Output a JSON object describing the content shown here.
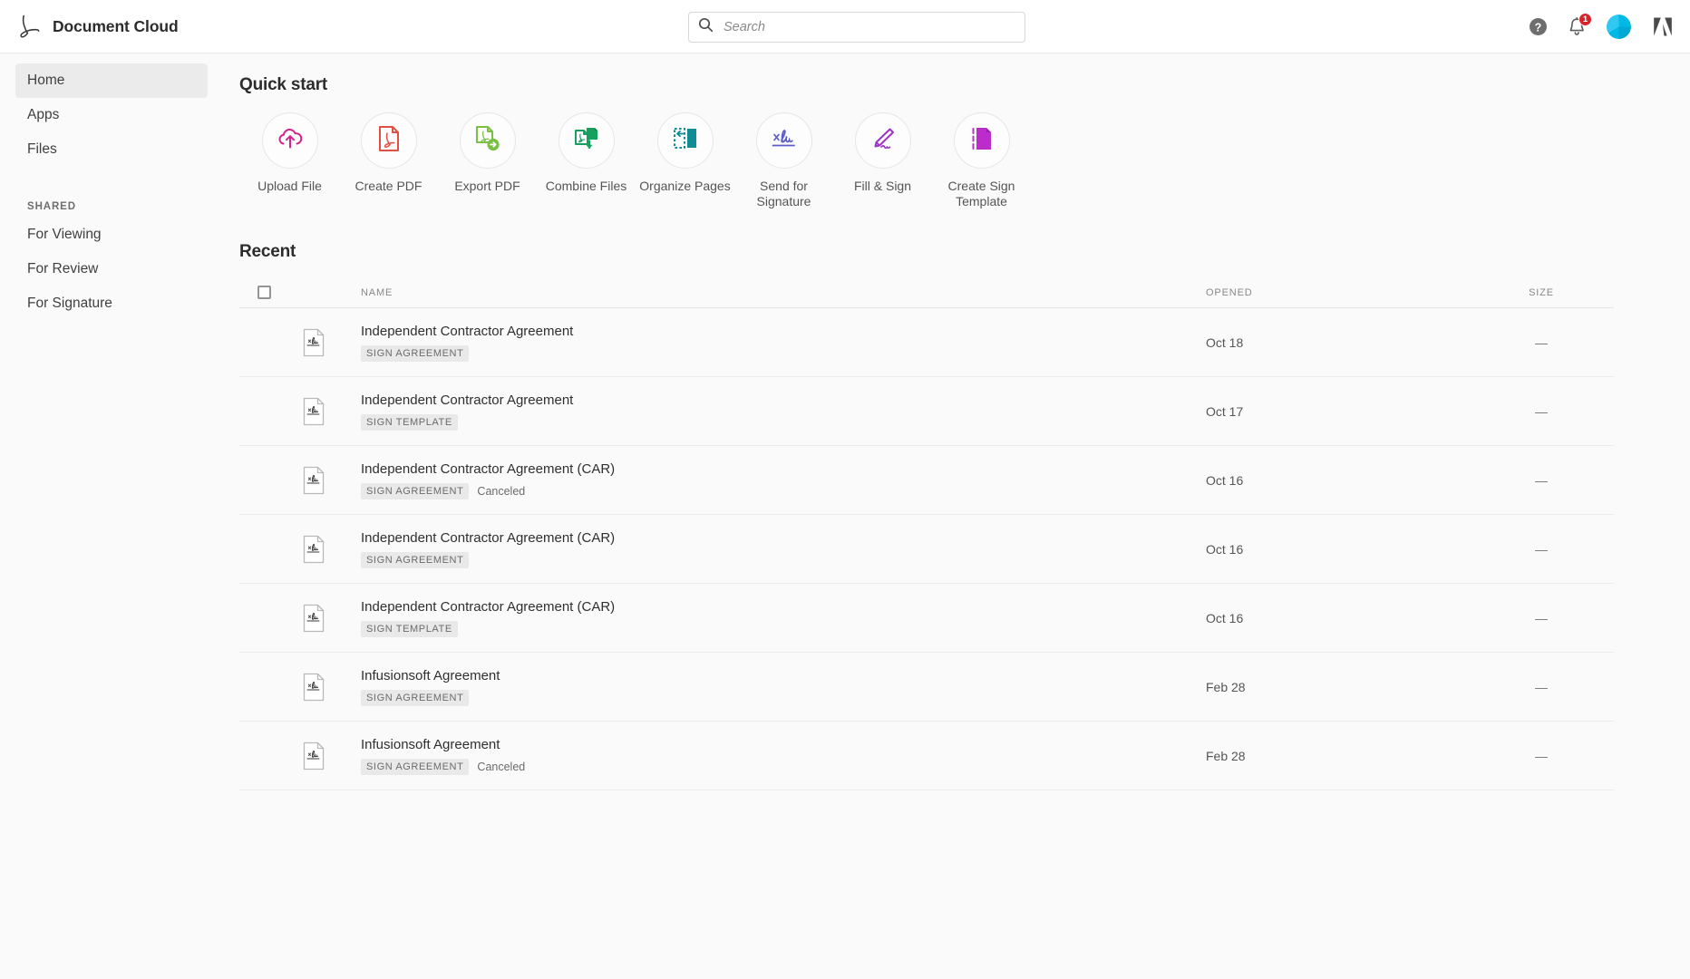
{
  "header": {
    "brand_title": "Document Cloud",
    "logo_icon": "adobe-acrobat-logo",
    "search": {
      "placeholder": "Search",
      "value": "",
      "icon": "search-icon"
    },
    "help_icon": "help-circle-icon",
    "notifications_icon": "bell-icon",
    "notifications_count": "1",
    "avatar_icon": "user-avatar",
    "adobe_logo_icon": "adobe-logo"
  },
  "sidebar": {
    "items": [
      {
        "label": "Home",
        "active": true
      },
      {
        "label": "Apps",
        "active": false
      },
      {
        "label": "Files",
        "active": false
      }
    ],
    "group_label": "SHARED",
    "shared_items": [
      {
        "label": "For Viewing"
      },
      {
        "label": "For Review"
      },
      {
        "label": "For Signature"
      }
    ]
  },
  "quick_start": {
    "title": "Quick start",
    "items": [
      {
        "label": "Upload File",
        "icon": "cloud-upload-icon",
        "color": "#d4218c"
      },
      {
        "label": "Create PDF",
        "icon": "pdf-document-icon",
        "color": "#e34f43"
      },
      {
        "label": "Export PDF",
        "icon": "export-pdf-icon",
        "color": "#7ac143"
      },
      {
        "label": "Combine Files",
        "icon": "combine-files-icon",
        "color": "#16a05d"
      },
      {
        "label": "Organize Pages",
        "icon": "organize-pages-icon",
        "color": "#0f8c94"
      },
      {
        "label": "Send for Signature",
        "icon": "signature-icon",
        "color": "#5c5ccc"
      },
      {
        "label": "Fill & Sign",
        "icon": "pen-sign-icon",
        "color": "#9b35c9"
      },
      {
        "label": "Create Sign Template",
        "icon": "sign-template-icon",
        "color": "#bb2ccb"
      }
    ]
  },
  "recent": {
    "title": "Recent",
    "columns": {
      "name": "NAME",
      "opened": "OPENED",
      "size": "SIZE"
    },
    "select_all_checked": false,
    "rows": [
      {
        "name": "Independent Contractor Agreement",
        "badge": "SIGN AGREEMENT",
        "status": "",
        "opened": "Oct 18",
        "size": "—",
        "icon": "sign-document-icon"
      },
      {
        "name": "Independent Contractor Agreement",
        "badge": "SIGN TEMPLATE",
        "status": "",
        "opened": "Oct 17",
        "size": "—",
        "icon": "sign-document-icon"
      },
      {
        "name": "Independent Contractor Agreement (CAR)",
        "badge": "SIGN AGREEMENT",
        "status": "Canceled",
        "opened": "Oct 16",
        "size": "—",
        "icon": "sign-document-icon"
      },
      {
        "name": "Independent Contractor Agreement (CAR)",
        "badge": "SIGN AGREEMENT",
        "status": "",
        "opened": "Oct 16",
        "size": "—",
        "icon": "sign-document-icon"
      },
      {
        "name": "Independent Contractor Agreement (CAR)",
        "badge": "SIGN TEMPLATE",
        "status": "",
        "opened": "Oct 16",
        "size": "—",
        "icon": "sign-document-icon"
      },
      {
        "name": "Infusionsoft Agreement",
        "badge": "SIGN AGREEMENT",
        "status": "",
        "opened": "Feb 28",
        "size": "—",
        "icon": "sign-document-icon"
      },
      {
        "name": "Infusionsoft Agreement",
        "badge": "SIGN AGREEMENT",
        "status": "Canceled",
        "opened": "Feb 28",
        "size": "—",
        "icon": "sign-document-icon"
      }
    ]
  }
}
